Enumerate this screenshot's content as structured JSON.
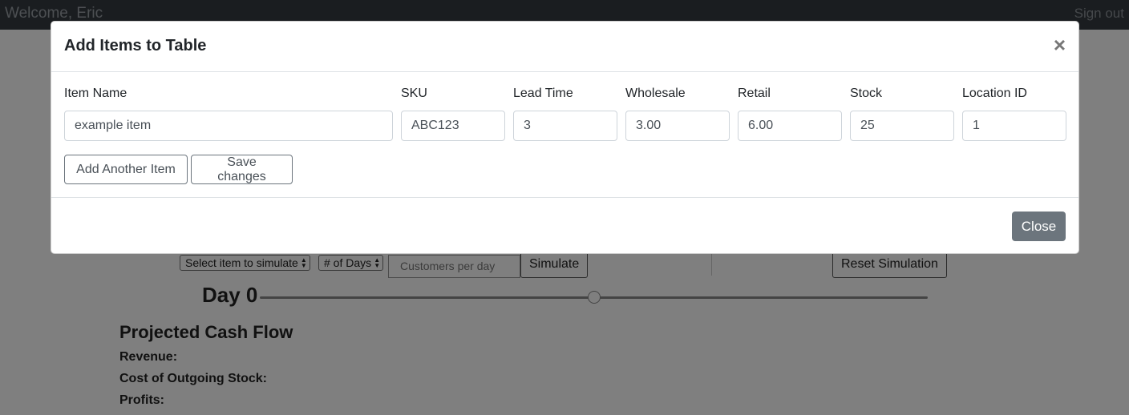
{
  "navbar": {
    "welcome": "Welcome, Eric",
    "signout": "Sign out"
  },
  "simulation": {
    "select_item_label": "Select item to simulate",
    "days_label": "# of Days",
    "customers_placeholder": "Customers per day",
    "simulate_label": "Simulate",
    "reset_label": "Reset Simulation",
    "day_label": "Day 0",
    "slider_fraction": 0.5
  },
  "cash_flow": {
    "title": "Projected Cash Flow",
    "revenue_label": "Revenue:",
    "cost_label": "Cost of Outgoing Stock:",
    "profits_label": "Profits:"
  },
  "modal": {
    "title": "Add Items to Table",
    "close_icon": "×",
    "fields": {
      "item_name": {
        "label": "Item Name",
        "value": "example item"
      },
      "sku": {
        "label": "SKU",
        "value": "ABC123"
      },
      "lead_time": {
        "label": "Lead Time",
        "value": "3"
      },
      "wholesale": {
        "label": "Wholesale",
        "value": "3.00"
      },
      "retail": {
        "label": "Retail",
        "value": "6.00"
      },
      "stock": {
        "label": "Stock",
        "value": "25"
      },
      "location_id": {
        "label": "Location ID",
        "value": "1"
      }
    },
    "add_another_label": "Add Another Item",
    "save_label": "Save changes",
    "close_label": "Close"
  },
  "colors": {
    "navbar": "#343a40",
    "secondary": "#6c757d",
    "backdrop": "rgba(0,0,0,0.5)"
  }
}
